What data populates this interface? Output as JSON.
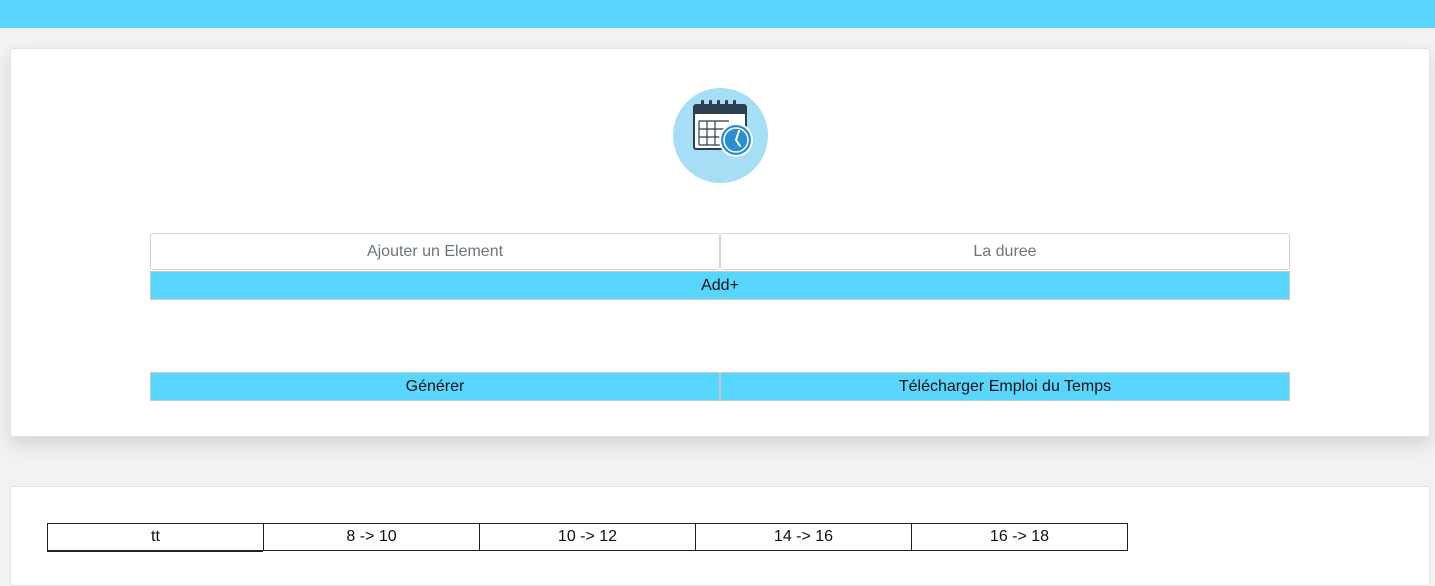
{
  "form": {
    "element_placeholder": "Ajouter un Element",
    "duree_placeholder": "La duree",
    "add_label": "Add+",
    "generer_label": "Générer",
    "telecharger_label": "Télécharger Emploi du Temps"
  },
  "schedule": {
    "headers": [
      "tt",
      "8 -> 10",
      "10 -> 12",
      "14 -> 16",
      "16 -> 18"
    ]
  },
  "colors": {
    "accent": "#58d6fd",
    "logo_bg": "#a6dff5",
    "clock": "#2b8fd1"
  },
  "icons": {
    "logo": "calendar-clock-icon"
  }
}
